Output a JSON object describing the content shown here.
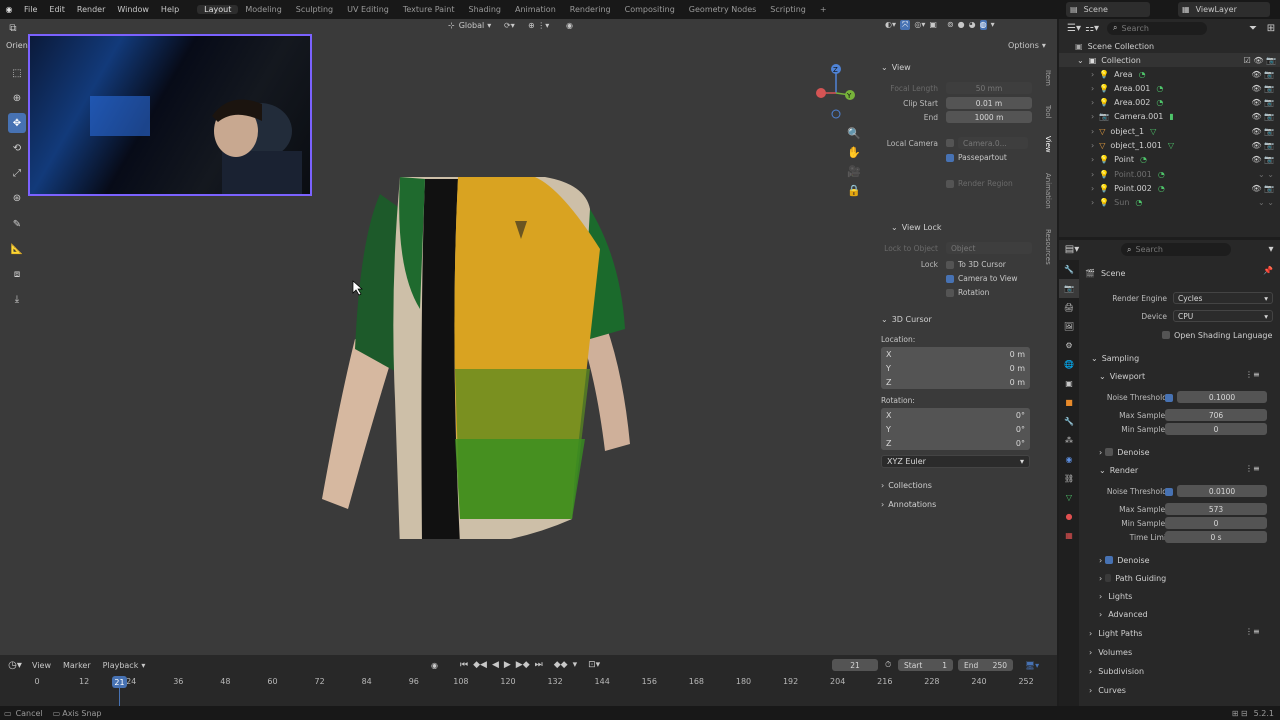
{
  "topbar": {
    "menus": [
      "File",
      "Edit",
      "Render",
      "Window",
      "Help"
    ],
    "workspaces": [
      "Layout",
      "Modeling",
      "Sculpting",
      "UV Editing",
      "Texture Paint",
      "Shading",
      "Animation",
      "Rendering",
      "Compositing",
      "Geometry Nodes",
      "Scripting"
    ],
    "active_workspace": "Layout",
    "add_tab": "+",
    "scene": "Scene",
    "view_layer": "ViewLayer"
  },
  "viewport": {
    "orientation_label": "Orient",
    "transform_orientation": "Global",
    "options_label": "Options",
    "gizmo": {
      "z": "Z",
      "y": "Y"
    }
  },
  "npanel": {
    "tabs": [
      "Item",
      "Tool",
      "View",
      "Animation",
      "Resources"
    ],
    "view": {
      "title": "View",
      "focal_length_label": "Focal Length",
      "focal_length": "50 mm",
      "clip_start_label": "Clip Start",
      "clip_start": "0.01 m",
      "end_label": "End",
      "end": "1000 m",
      "local_camera_label": "Local Camera",
      "local_camera": "Camera.0...",
      "passepartout": "Passepartout",
      "render_region": "Render Region"
    },
    "view_lock": {
      "title": "View Lock",
      "lock_object_label": "Lock to Object",
      "lock_object_placeholder": "Object",
      "lock_label": "Lock",
      "to_3d_cursor": "To 3D Cursor",
      "camera_to_view": "Camera to View",
      "rotation": "Rotation"
    },
    "cursor": {
      "title": "3D Cursor",
      "location_label": "Location:",
      "loc": [
        {
          "axis": "X",
          "value": "0 m"
        },
        {
          "axis": "Y",
          "value": "0 m"
        },
        {
          "axis": "Z",
          "value": "0 m"
        }
      ],
      "rotation_label": "Rotation:",
      "rot": [
        {
          "axis": "X",
          "value": "0°"
        },
        {
          "axis": "Y",
          "value": "0°"
        },
        {
          "axis": "Z",
          "value": "0°"
        }
      ],
      "mode": "XYZ Euler"
    },
    "collections": "Collections",
    "annotations": "Annotations"
  },
  "outliner": {
    "search_placeholder": "Search",
    "root": "Scene Collection",
    "collection": "Collection",
    "items": [
      "Area",
      "Area.001",
      "Area.002",
      "Camera.001",
      "object_1",
      "object_1.001",
      "Point",
      "Point.001",
      "Point.002",
      "Sun"
    ]
  },
  "properties": {
    "search_placeholder": "Search",
    "scene": "Scene",
    "render_engine_label": "Render Engine",
    "render_engine": "Cycles",
    "device_label": "Device",
    "device": "CPU",
    "osl": "Open Shading Language",
    "sampling": "Sampling",
    "viewport": "Viewport",
    "noise_threshold_label": "Noise Threshold",
    "vp_noise": "0.1000",
    "max_samples_label": "Max Samples",
    "vp_max": "706",
    "min_samples_label": "Min Samples",
    "vp_min": "0",
    "denoise": "Denoise",
    "render": "Render",
    "r_noise": "0.0100",
    "r_max": "573",
    "r_min": "0",
    "time_limit_label": "Time Limit",
    "time_limit": "0 s",
    "denoise2": "Denoise",
    "path_guiding": "Path Guiding",
    "lights": "Lights",
    "advanced": "Advanced",
    "light_paths": "Light Paths",
    "volumes": "Volumes",
    "subdivision": "Subdivision",
    "curves": "Curves"
  },
  "timeline": {
    "view": "View",
    "marker": "Marker",
    "playback": "Playback",
    "current_frame": "21",
    "start_label": "Start",
    "start": "1",
    "end_label": "End",
    "end": "250",
    "ticks": [
      "0",
      "12",
      "24",
      "36",
      "48",
      "60",
      "72",
      "84",
      "96",
      "108",
      "120",
      "132",
      "144",
      "156",
      "168",
      "180",
      "192",
      "204",
      "216",
      "228",
      "240",
      "252"
    ],
    "playhead": "21"
  },
  "status": {
    "cancel": "Cancel",
    "axis_snap": "Axis Snap",
    "version": "5.2.1"
  }
}
